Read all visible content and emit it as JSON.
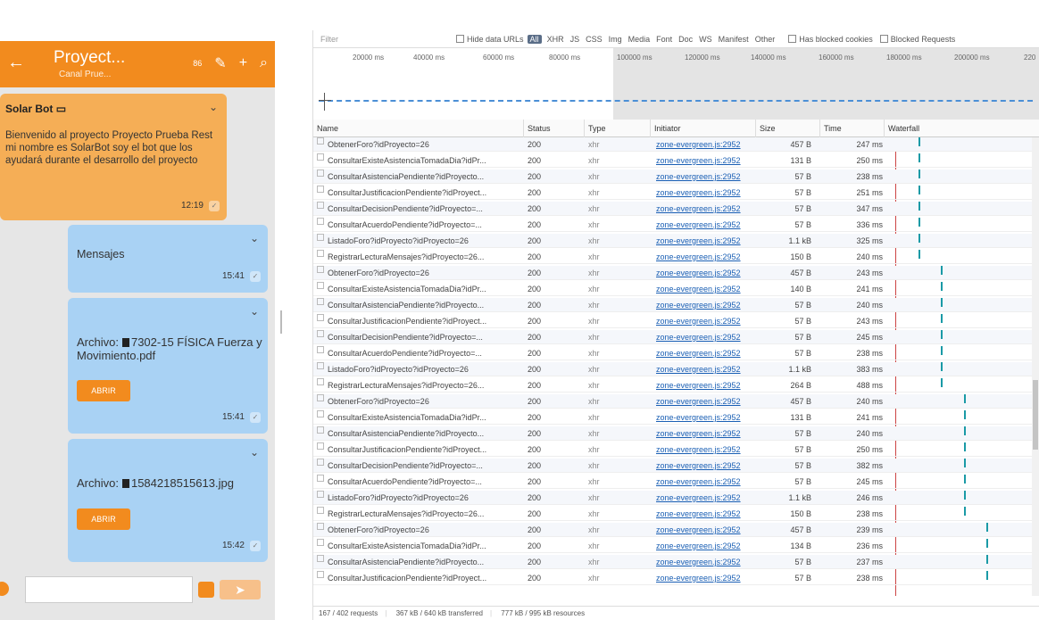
{
  "chat": {
    "header": {
      "title": "Proyect...",
      "subtitle": "Canal Prue...",
      "count": "86",
      "back": "←",
      "edit": "✎",
      "add": "+",
      "search": "⌕"
    },
    "bot_message": {
      "sender": "Solar Bot",
      "text": "Bienvenido al proyecto Proyecto Prueba Rest mi nombre es SolarBot soy el bot que los ayudará durante el desarrollo del proyecto",
      "time": "12:19"
    },
    "messages": [
      {
        "text": "Mensajes",
        "time": "15:41"
      },
      {
        "prefix": "Archivo:",
        "file": "7302-15 FÍSICA Fuerza y Movimiento.pdf",
        "button": "ABRIR",
        "time": "15:41"
      },
      {
        "prefix": "Archivo:",
        "file": "1584218515613.jpg",
        "button": "ABRIR",
        "time": "15:42"
      }
    ],
    "composer": {
      "placeholder": ""
    }
  },
  "devtools": {
    "filter": {
      "placeholder": "Filter",
      "hide_data_urls": "Hide data URLs",
      "all": "All",
      "types": [
        "XHR",
        "JS",
        "CSS",
        "Img",
        "Media",
        "Font",
        "Doc",
        "WS",
        "Manifest",
        "Other"
      ],
      "has_blocked_cookies": "Has blocked cookies",
      "blocked_requests": "Blocked Requests"
    },
    "overview_ticks": [
      "20000 ms",
      "40000 ms",
      "60000 ms",
      "80000 ms",
      "100000 ms",
      "120000 ms",
      "140000 ms",
      "160000 ms",
      "180000 ms",
      "200000 ms",
      "220"
    ],
    "columns": {
      "name": "Name",
      "status": "Status",
      "type": "Type",
      "initiator": "Initiator",
      "size": "Size",
      "time": "Time",
      "waterfall": "Waterfall"
    },
    "rows": [
      {
        "name": "ObtenerForo?idProyecto=26",
        "status": "200",
        "type": "xhr",
        "initiator": "zone-evergreen.js:2952",
        "size": "457 B",
        "time": "247 ms",
        "wf": 0.2
      },
      {
        "name": "ConsultarExisteAsistenciaTomadaDia?idPr...",
        "status": "200",
        "type": "xhr",
        "initiator": "zone-evergreen.js:2952",
        "size": "131 B",
        "time": "250 ms",
        "wf": 0.2
      },
      {
        "name": "ConsultarAsistenciaPendiente?idProyecto...",
        "status": "200",
        "type": "xhr",
        "initiator": "zone-evergreen.js:2952",
        "size": "57 B",
        "time": "238 ms",
        "wf": 0.2
      },
      {
        "name": "ConsultarJustificacionPendiente?idProyect...",
        "status": "200",
        "type": "xhr",
        "initiator": "zone-evergreen.js:2952",
        "size": "57 B",
        "time": "251 ms",
        "wf": 0.2
      },
      {
        "name": "ConsultarDecisionPendiente?idProyecto=...",
        "status": "200",
        "type": "xhr",
        "initiator": "zone-evergreen.js:2952",
        "size": "57 B",
        "time": "347 ms",
        "wf": 0.2
      },
      {
        "name": "ConsultarAcuerdoPendiente?idProyecto=...",
        "status": "200",
        "type": "xhr",
        "initiator": "zone-evergreen.js:2952",
        "size": "57 B",
        "time": "336 ms",
        "wf": 0.2
      },
      {
        "name": "ListadoForo?idProyecto?idProyecto=26",
        "status": "200",
        "type": "xhr",
        "initiator": "zone-evergreen.js:2952",
        "size": "1.1 kB",
        "time": "325 ms",
        "wf": 0.2
      },
      {
        "name": "RegistrarLecturaMensajes?idProyecto=26...",
        "status": "200",
        "type": "xhr",
        "initiator": "zone-evergreen.js:2952",
        "size": "150 B",
        "time": "240 ms",
        "wf": 0.2
      },
      {
        "name": "ObtenerForo?idProyecto=26",
        "status": "200",
        "type": "xhr",
        "initiator": "zone-evergreen.js:2952",
        "size": "457 B",
        "time": "243 ms",
        "wf": 0.36
      },
      {
        "name": "ConsultarExisteAsistenciaTomadaDia?idPr...",
        "status": "200",
        "type": "xhr",
        "initiator": "zone-evergreen.js:2952",
        "size": "140 B",
        "time": "241 ms",
        "wf": 0.36
      },
      {
        "name": "ConsultarAsistenciaPendiente?idProyecto...",
        "status": "200",
        "type": "xhr",
        "initiator": "zone-evergreen.js:2952",
        "size": "57 B",
        "time": "240 ms",
        "wf": 0.36
      },
      {
        "name": "ConsultarJustificacionPendiente?idProyect...",
        "status": "200",
        "type": "xhr",
        "initiator": "zone-evergreen.js:2952",
        "size": "57 B",
        "time": "243 ms",
        "wf": 0.36
      },
      {
        "name": "ConsultarDecisionPendiente?idProyecto=...",
        "status": "200",
        "type": "xhr",
        "initiator": "zone-evergreen.js:2952",
        "size": "57 B",
        "time": "245 ms",
        "wf": 0.36
      },
      {
        "name": "ConsultarAcuerdoPendiente?idProyecto=...",
        "status": "200",
        "type": "xhr",
        "initiator": "zone-evergreen.js:2952",
        "size": "57 B",
        "time": "238 ms",
        "wf": 0.36
      },
      {
        "name": "ListadoForo?idProyecto?idProyecto=26",
        "status": "200",
        "type": "xhr",
        "initiator": "zone-evergreen.js:2952",
        "size": "1.1 kB",
        "time": "383 ms",
        "wf": 0.36
      },
      {
        "name": "RegistrarLecturaMensajes?idProyecto=26...",
        "status": "200",
        "type": "xhr",
        "initiator": "zone-evergreen.js:2952",
        "size": "264 B",
        "time": "488 ms",
        "wf": 0.36
      },
      {
        "name": "ObtenerForo?idProyecto=26",
        "status": "200",
        "type": "xhr",
        "initiator": "zone-evergreen.js:2952",
        "size": "457 B",
        "time": "240 ms",
        "wf": 0.53
      },
      {
        "name": "ConsultarExisteAsistenciaTomadaDia?idPr...",
        "status": "200",
        "type": "xhr",
        "initiator": "zone-evergreen.js:2952",
        "size": "131 B",
        "time": "241 ms",
        "wf": 0.53
      },
      {
        "name": "ConsultarAsistenciaPendiente?idProyecto...",
        "status": "200",
        "type": "xhr",
        "initiator": "zone-evergreen.js:2952",
        "size": "57 B",
        "time": "240 ms",
        "wf": 0.53
      },
      {
        "name": "ConsultarJustificacionPendiente?idProyect...",
        "status": "200",
        "type": "xhr",
        "initiator": "zone-evergreen.js:2952",
        "size": "57 B",
        "time": "250 ms",
        "wf": 0.53
      },
      {
        "name": "ConsultarDecisionPendiente?idProyecto=...",
        "status": "200",
        "type": "xhr",
        "initiator": "zone-evergreen.js:2952",
        "size": "57 B",
        "time": "382 ms",
        "wf": 0.53
      },
      {
        "name": "ConsultarAcuerdoPendiente?idProyecto=...",
        "status": "200",
        "type": "xhr",
        "initiator": "zone-evergreen.js:2952",
        "size": "57 B",
        "time": "245 ms",
        "wf": 0.53
      },
      {
        "name": "ListadoForo?idProyecto?idProyecto=26",
        "status": "200",
        "type": "xhr",
        "initiator": "zone-evergreen.js:2952",
        "size": "1.1 kB",
        "time": "246 ms",
        "wf": 0.53
      },
      {
        "name": "RegistrarLecturaMensajes?idProyecto=26...",
        "status": "200",
        "type": "xhr",
        "initiator": "zone-evergreen.js:2952",
        "size": "150 B",
        "time": "238 ms",
        "wf": 0.53
      },
      {
        "name": "ObtenerForo?idProyecto=26",
        "status": "200",
        "type": "xhr",
        "initiator": "zone-evergreen.js:2952",
        "size": "457 B",
        "time": "239 ms",
        "wf": 0.7
      },
      {
        "name": "ConsultarExisteAsistenciaTomadaDia?idPr...",
        "status": "200",
        "type": "xhr",
        "initiator": "zone-evergreen.js:2952",
        "size": "134 B",
        "time": "236 ms",
        "wf": 0.7
      },
      {
        "name": "ConsultarAsistenciaPendiente?idProyecto...",
        "status": "200",
        "type": "xhr",
        "initiator": "zone-evergreen.js:2952",
        "size": "57 B",
        "time": "237 ms",
        "wf": 0.7
      },
      {
        "name": "ConsultarJustificacionPendiente?idProyect...",
        "status": "200",
        "type": "xhr",
        "initiator": "zone-evergreen.js:2952",
        "size": "57 B",
        "time": "238 ms",
        "wf": 0.7
      }
    ],
    "status_bar": {
      "requests": "167 / 402 requests",
      "transferred": "367 kB / 640 kB transferred",
      "resources": "777 kB / 995 kB resources"
    }
  },
  "colors": {
    "accent": "#f28b1e",
    "bot_bubble": "#f5ae56",
    "user_bubble": "#a9d2f4",
    "waterfall_bar": "#1a9aa6"
  }
}
